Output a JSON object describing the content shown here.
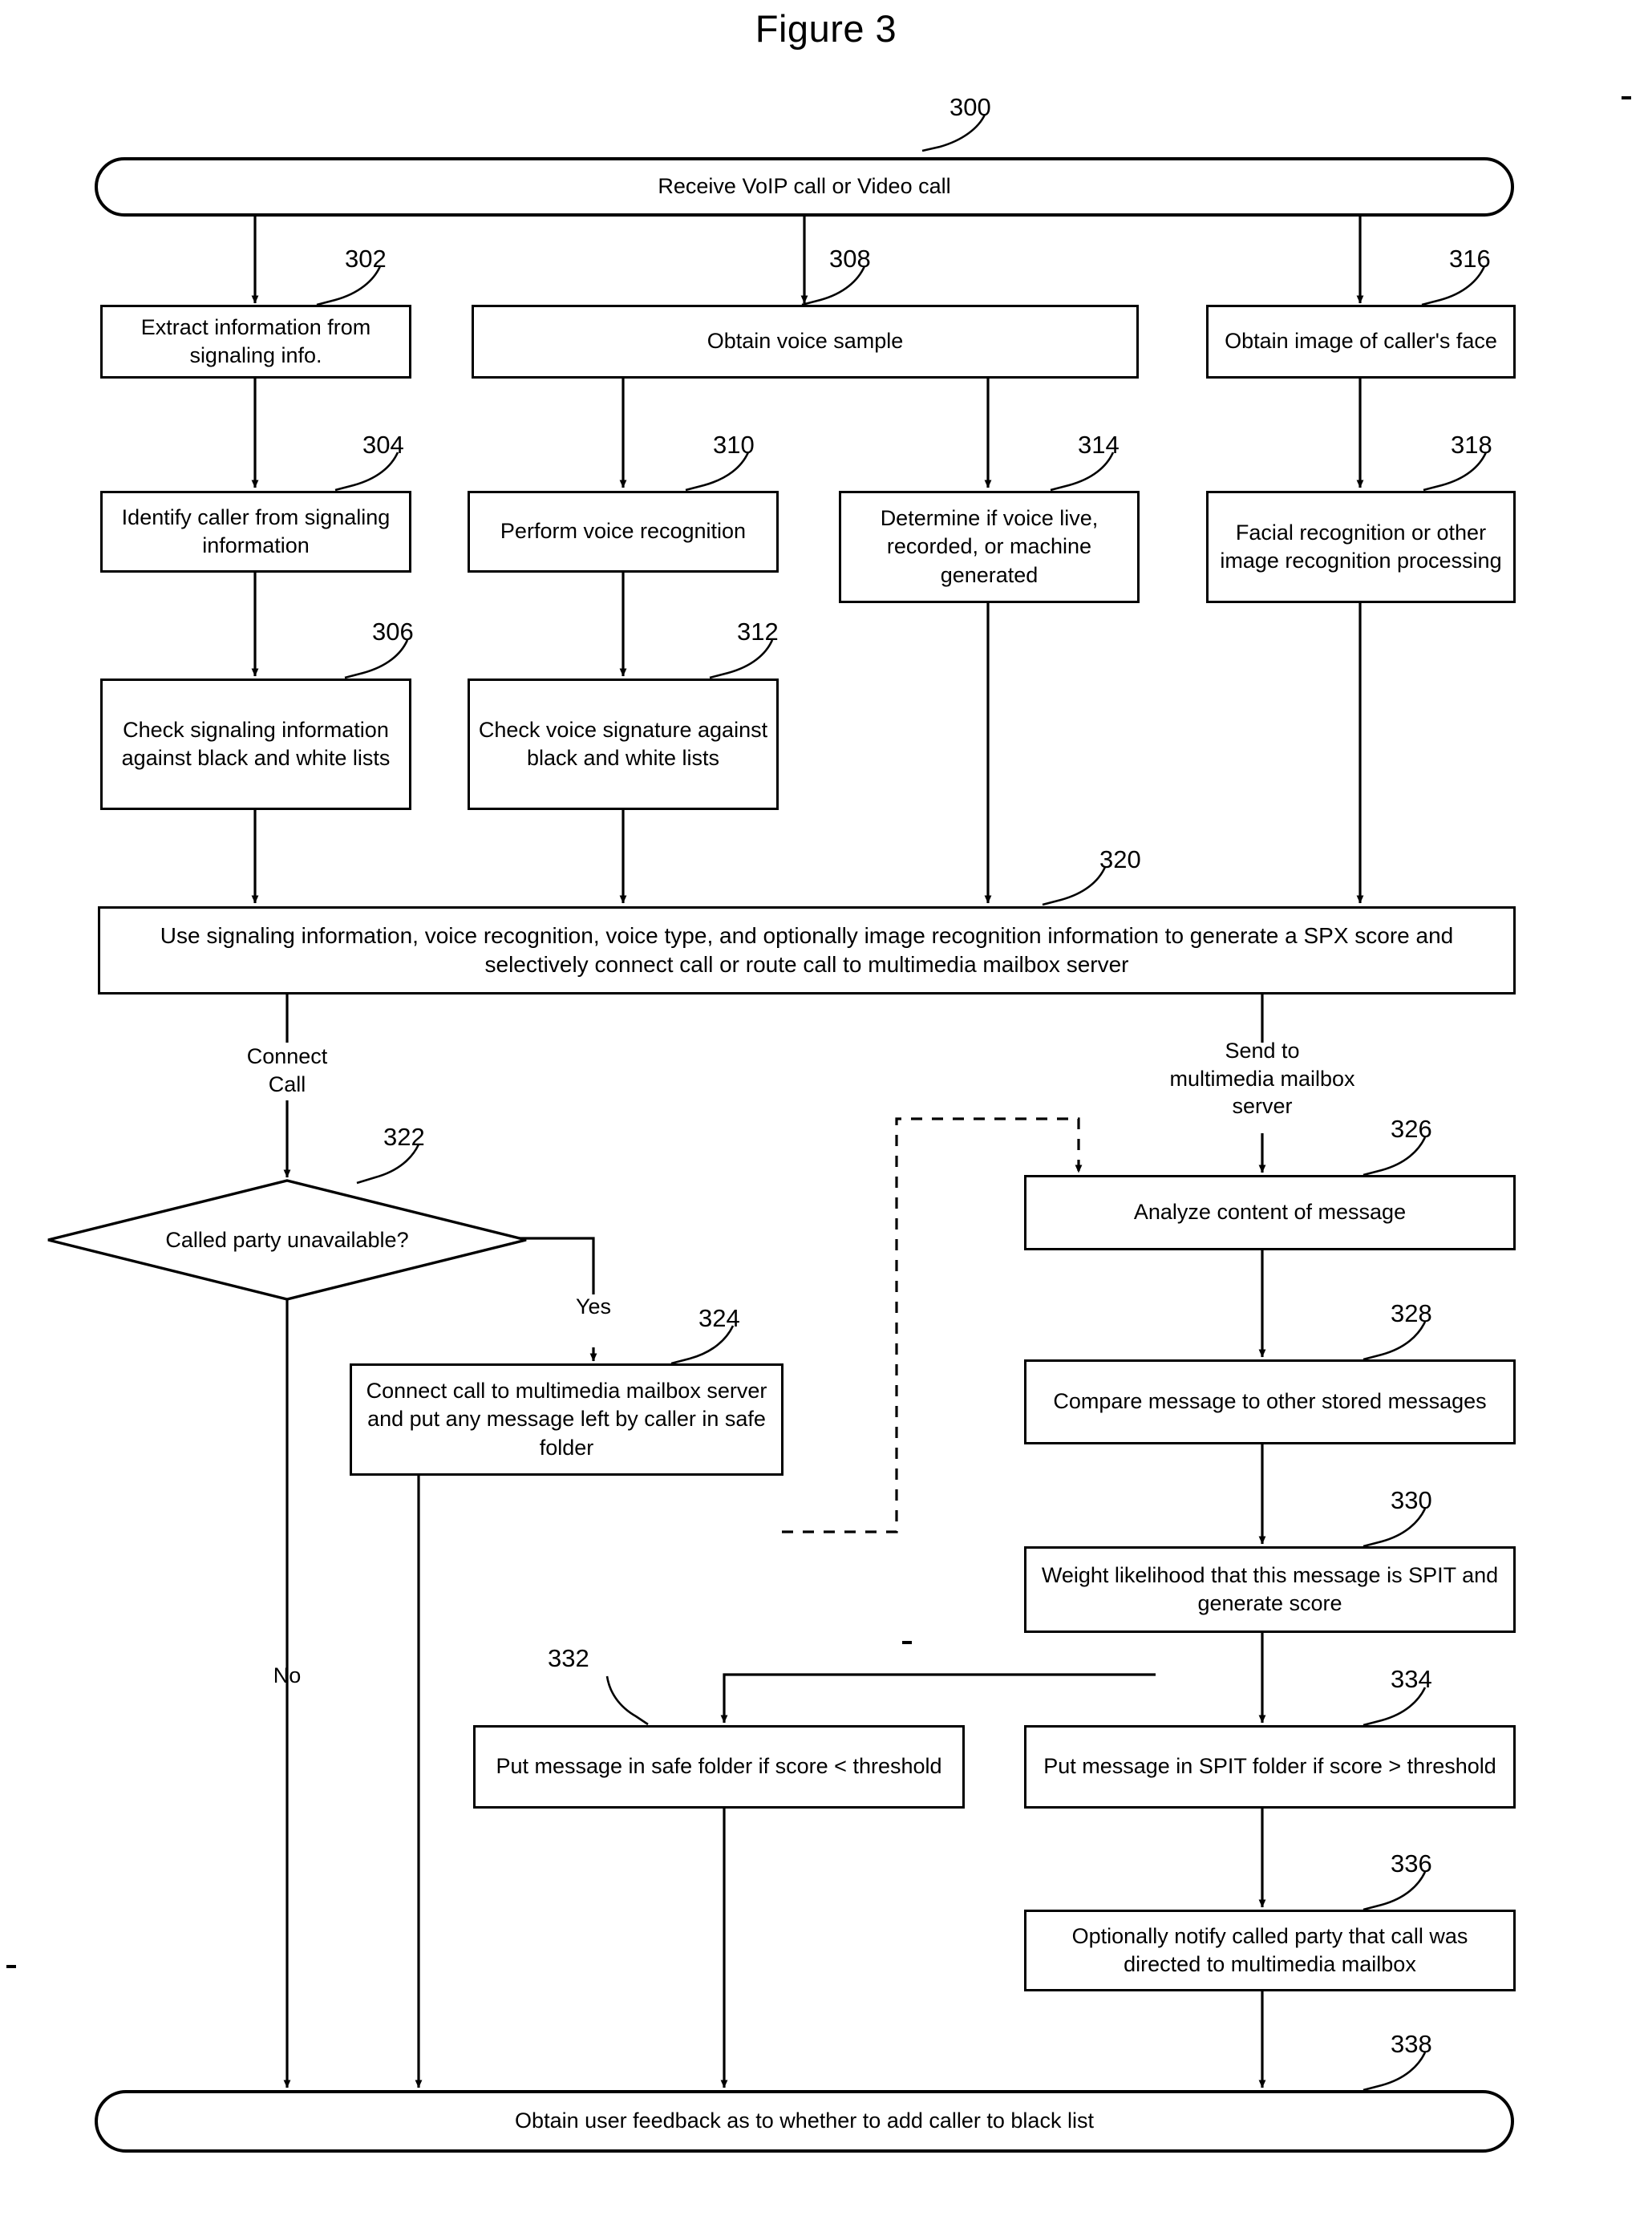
{
  "figure": {
    "title": "Figure 3"
  },
  "nodes": {
    "n300": {
      "ref": "300",
      "text": "Receive VoIP call or Video call"
    },
    "n302": {
      "ref": "302",
      "text": "Extract information from signaling info."
    },
    "n304": {
      "ref": "304",
      "text": "Identify caller from signaling information"
    },
    "n306": {
      "ref": "306",
      "text": "Check signaling information against black and white lists"
    },
    "n308": {
      "ref": "308",
      "text": "Obtain voice sample"
    },
    "n310": {
      "ref": "310",
      "text": "Perform voice recognition"
    },
    "n312": {
      "ref": "312",
      "text": "Check voice signature against black and white lists"
    },
    "n314": {
      "ref": "314",
      "text": "Determine if voice live, recorded, or machine generated"
    },
    "n316": {
      "ref": "316",
      "text": "Obtain image of caller's face"
    },
    "n318": {
      "ref": "318",
      "text": "Facial recognition or other image recognition processing"
    },
    "n320": {
      "ref": "320",
      "text": "Use signaling information, voice recognition, voice type, and optionally image recognition information to generate a SPX score and selectively connect call or route call to multimedia mailbox server"
    },
    "n322": {
      "ref": "322",
      "text": "Called party unavailable?"
    },
    "n324": {
      "ref": "324",
      "text": "Connect call to multimedia mailbox server and put any message left by caller in safe folder"
    },
    "n326": {
      "ref": "326",
      "text": "Analyze content of message"
    },
    "n328": {
      "ref": "328",
      "text": "Compare message to other stored messages"
    },
    "n330": {
      "ref": "330",
      "text": "Weight likelihood that this message is SPIT and generate score"
    },
    "n332": {
      "ref": "332",
      "text": "Put message in safe folder if score < threshold"
    },
    "n334": {
      "ref": "334",
      "text": "Put message in SPIT folder if score > threshold"
    },
    "n336": {
      "ref": "336",
      "text": "Optionally notify called party that call was directed to multimedia mailbox"
    },
    "n338": {
      "ref": "338",
      "text": "Obtain user feedback as to whether to add caller to black list"
    }
  },
  "edge_labels": {
    "connect_call": "Connect\nCall",
    "send_to_mailbox": "Send to\nmultimedia mailbox\nserver",
    "yes": "Yes",
    "no": "No"
  },
  "colors": {
    "stroke": "#000000",
    "background": "#ffffff"
  }
}
